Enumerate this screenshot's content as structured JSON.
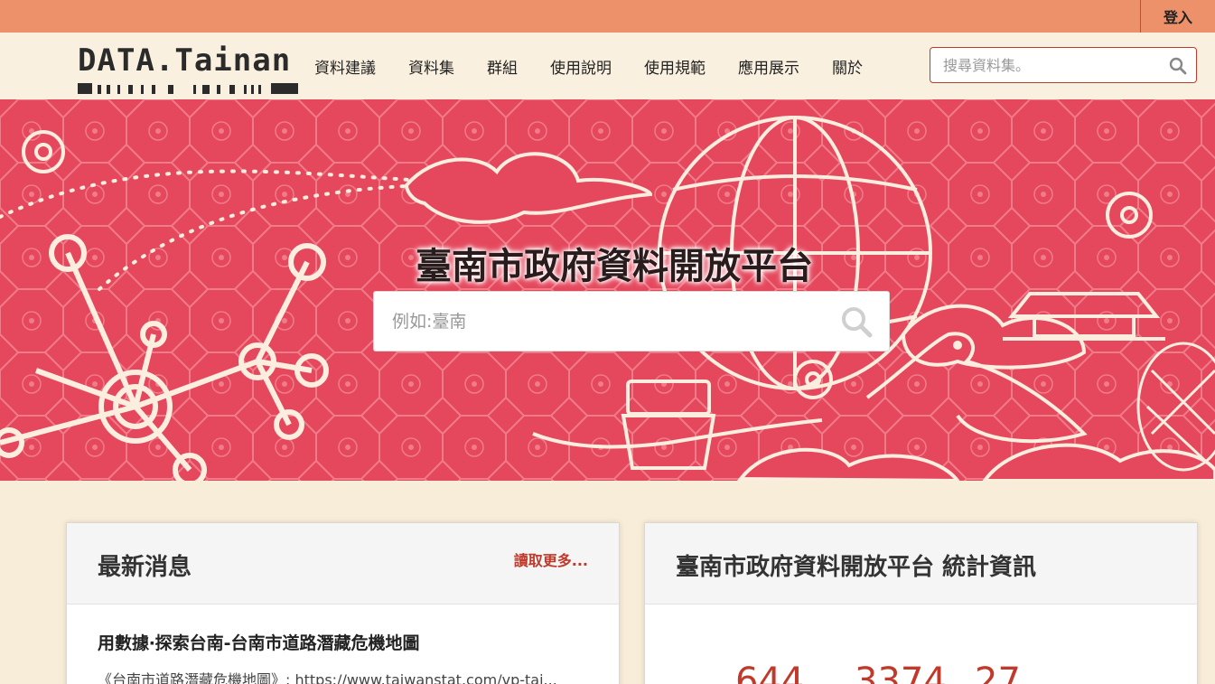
{
  "topbar": {
    "login_label": "登入"
  },
  "brand": {
    "logo_text": "DATA.Tainan"
  },
  "nav": {
    "items": [
      "資料建議",
      "資料集",
      "群組",
      "使用說明",
      "使用規範",
      "應用展示",
      "關於"
    ],
    "search_placeholder": "搜尋資料集。"
  },
  "hero": {
    "title": "臺南市政府資料開放平台",
    "search_placeholder": "例如:臺南"
  },
  "news": {
    "heading": "最新消息",
    "read_more": "讀取更多...",
    "item_title": "用數據‧探索台南-台南市道路潛藏危機地圖",
    "item_snippet": "《台南市道路潛藏危機地圖》: https://www.taiwanstat.com/vp-tai..."
  },
  "stats": {
    "heading": "臺南市政府資料開放平台 統計資訊",
    "values": [
      "644",
      "3374",
      "27"
    ]
  },
  "colors": {
    "accent": "#c0392b",
    "hero_bg": "#e5485d",
    "topbar": "#ec916a",
    "page_bg": "#f8edd9"
  }
}
